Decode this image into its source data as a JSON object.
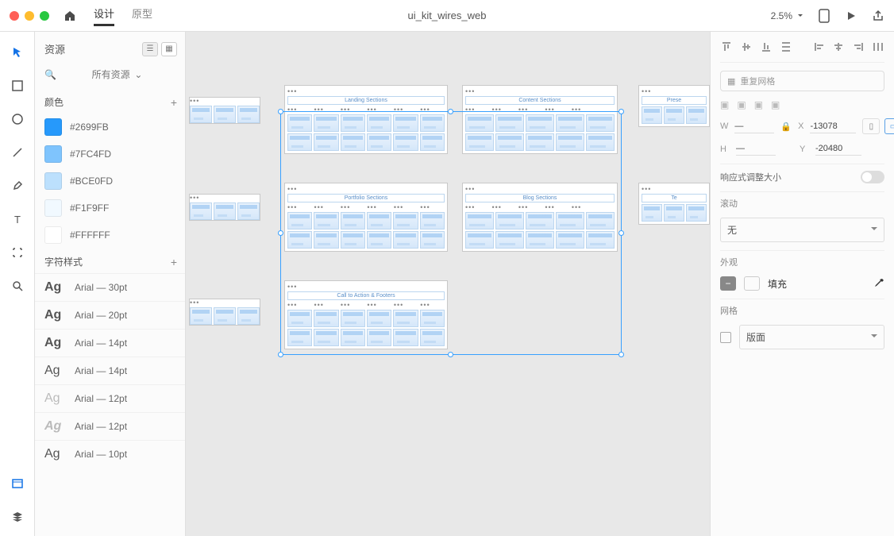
{
  "titlebar": {
    "tabs": {
      "design": "设计",
      "prototype": "原型"
    },
    "document": "ui_kit_wires_web",
    "zoom": "2.5%"
  },
  "sidebar": {
    "title": "资源",
    "search": "所有资源",
    "colors_label": "颜色",
    "colors": [
      {
        "hex": "#2699FB",
        "label": "#2699FB"
      },
      {
        "hex": "#7FC4FD",
        "label": "#7FC4FD"
      },
      {
        "hex": "#BCE0FD",
        "label": "#BCE0FD"
      },
      {
        "hex": "#F1F9FF",
        "label": "#F1F9FF"
      },
      {
        "hex": "#FFFFFF",
        "label": "#FFFFFF"
      }
    ],
    "char_styles_label": "字符样式",
    "fonts": [
      {
        "label": "Arial — 30pt",
        "variant": "bold"
      },
      {
        "label": "Arial — 20pt",
        "variant": "bold"
      },
      {
        "label": "Arial — 14pt",
        "variant": "bold"
      },
      {
        "label": "Arial — 14pt",
        "variant": "regular"
      },
      {
        "label": "Arial — 12pt",
        "variant": "light"
      },
      {
        "label": "Arial — 12pt",
        "variant": "italic"
      },
      {
        "label": "Arial — 10pt",
        "variant": "regular"
      }
    ]
  },
  "canvas": {
    "artboards": [
      {
        "title": "Landing Sections"
      },
      {
        "title": "Content Sections"
      },
      {
        "title": "Portfolio Sections"
      },
      {
        "title": "Blog Sections"
      },
      {
        "title": "Call to Action & Footers"
      }
    ]
  },
  "properties": {
    "repeat_grid": "重复网格",
    "w_label": "W",
    "h_label": "H",
    "x_label": "X",
    "y_label": "Y",
    "x_value": "-13078",
    "y_value": "-20480",
    "responsive_label": "响应式调整大小",
    "scroll_label": "滚动",
    "scroll_value": "无",
    "appearance_label": "外观",
    "fill_label": "填充",
    "grid_label": "网格",
    "grid_value": "版面"
  }
}
